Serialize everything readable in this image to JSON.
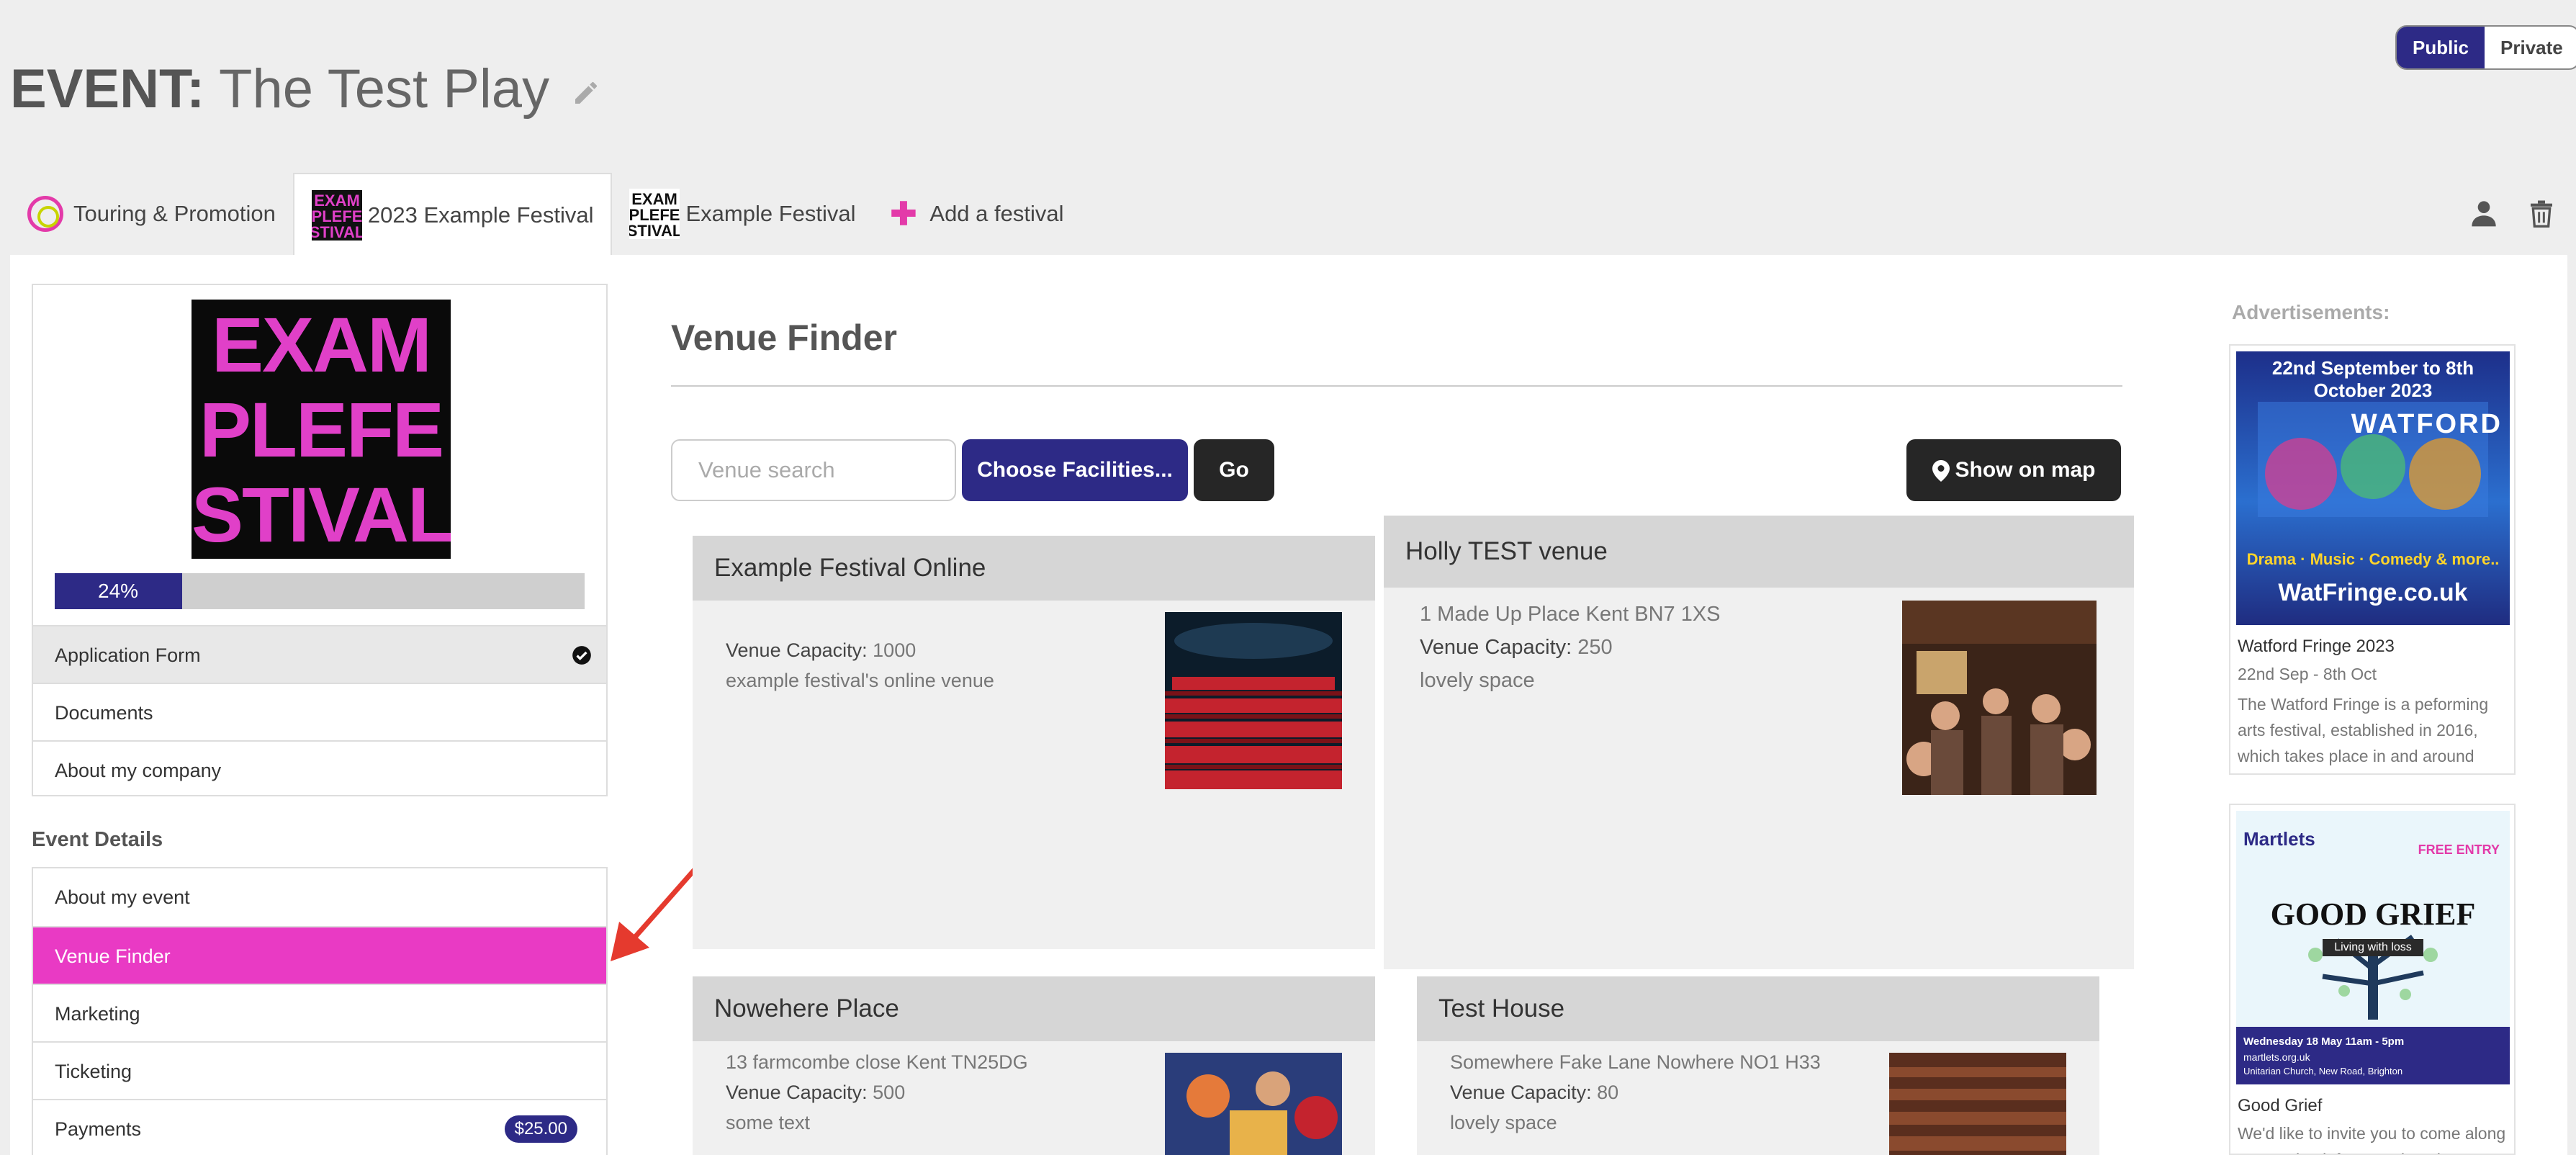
{
  "header": {
    "event_label": "EVENT:",
    "event_name": "The Test Play",
    "visibility": {
      "public": "Public",
      "private": "Private",
      "selected": "Public"
    }
  },
  "tabs": [
    {
      "label": "Touring & Promotion",
      "icon": "touring-promotion-icon",
      "active": false
    },
    {
      "label": "2023 Example Festival",
      "icon": "festival-logo",
      "active": true
    },
    {
      "label": "Example Festival",
      "icon": "festival-logo",
      "active": false
    },
    {
      "label": "Add a festival",
      "icon": "plus-icon",
      "active": false
    }
  ],
  "sidebar": {
    "poster_lines": [
      "EXAM",
      "PLEFE",
      "STIVAL"
    ],
    "progress": {
      "label": "24%",
      "value": 24
    },
    "application_items": [
      {
        "label": "Application Form",
        "completed": true
      },
      {
        "label": "Documents"
      },
      {
        "label": "About my company"
      }
    ],
    "event_details_heading": "Event Details",
    "event_items": [
      {
        "label": "About my event"
      },
      {
        "label": "Venue Finder",
        "active": true
      },
      {
        "label": "Marketing"
      },
      {
        "label": "Ticketing"
      },
      {
        "label": "Payments",
        "badge": "$25.00"
      }
    ]
  },
  "venue_finder": {
    "title": "Venue Finder",
    "search_placeholder": "Venue search",
    "choose_facilities": "Choose Facilities...",
    "go": "Go",
    "show_on_map": "Show on map",
    "venues": [
      {
        "name": "Example Festival Online",
        "address": "",
        "capacity_label": "Venue Capacity:",
        "capacity": "1000",
        "description": "example festival's online venue"
      },
      {
        "name": "Holly TEST venue",
        "address": "1 Made Up Place Kent BN7 1XS",
        "capacity_label": "Venue Capacity:",
        "capacity": "250",
        "description": "lovely space"
      },
      {
        "name": "Nowehere Place",
        "address": "13 farmcombe close Kent TN25DG",
        "capacity_label": "Venue Capacity:",
        "capacity": "500",
        "description": "some text"
      },
      {
        "name": "Test House",
        "address": "Somewhere Fake Lane Nowhere NO1 H33",
        "capacity_label": "Venue Capacity:",
        "capacity": "80",
        "description": "lovely space"
      }
    ]
  },
  "ads": {
    "label": "Advertisements:",
    "items": [
      {
        "title": "Watford Fringe 2023",
        "dates": "22nd Sep - 8th Oct",
        "description": "The Watford Fringe is a peforming arts festival, established in 2016, which takes place in and around Watford, which is close to London",
        "image_text": {
          "top": "22nd September to 8th October 2023",
          "brand": "WATFORD",
          "tags": "Drama · Music · Comedy & more..",
          "site": "WatFringe.co.uk"
        }
      },
      {
        "title": "Good Grief",
        "description": "We'd like to invite you to come along to 'Good Grief' on Wednesday",
        "image_text": {
          "brand": "Martlets",
          "free": "FREE ENTRY",
          "headline": "GOOD GRIEF",
          "sub": "Living with loss",
          "date": "Wednesday 18 May 11am - 5pm",
          "site": "martlets.org.uk",
          "place": "Unitarian Church, New Road, Brighton"
        }
      }
    ]
  },
  "colors": {
    "primary": "#2d2a86",
    "accent": "#e93ac4",
    "dark_button": "#262626"
  }
}
